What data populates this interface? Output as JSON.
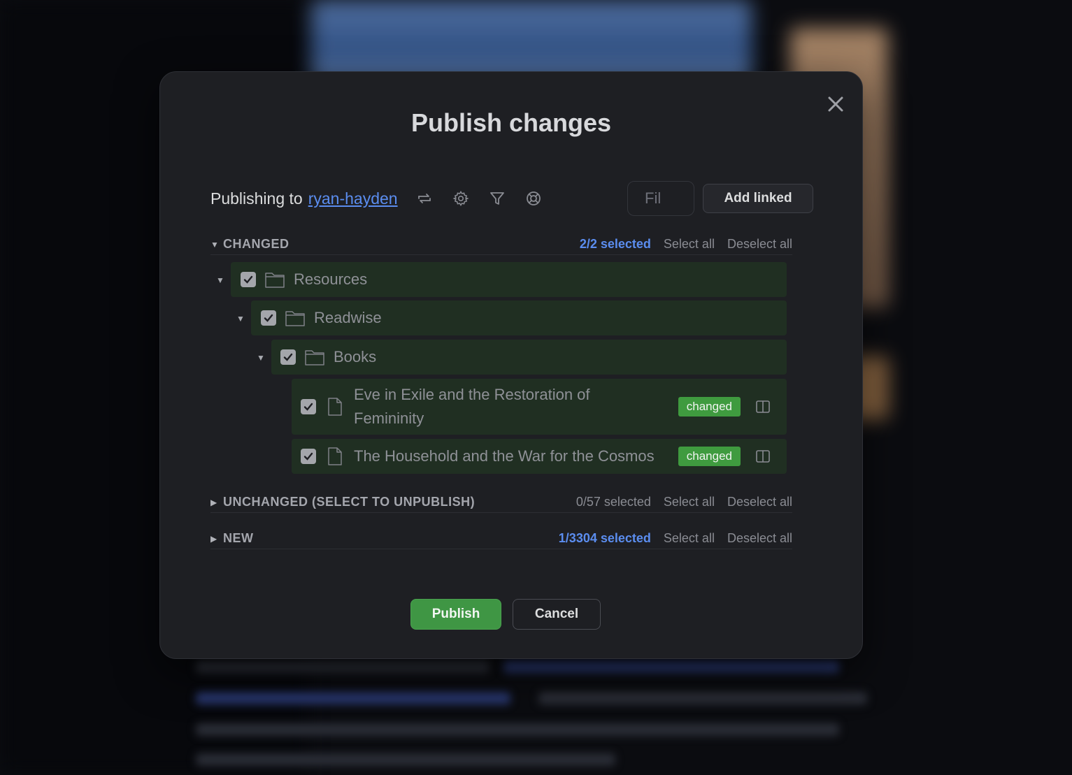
{
  "modal": {
    "title": "Publish changes",
    "publishing_to_label": "Publishing to",
    "target_name": "ryan-hayden",
    "filter_placeholder": "Fil",
    "add_linked_label": "Add linked"
  },
  "toolbar_icons": [
    "sync-icon",
    "gear-icon",
    "filter-icon",
    "help-lifebuoy-icon"
  ],
  "sections": {
    "changed": {
      "title": "CHANGED",
      "count": "2/2 selected",
      "select_all": "Select all",
      "deselect_all": "Deselect all",
      "expanded": true
    },
    "unchanged": {
      "title": "UNCHANGED (SELECT TO UNPUBLISH)",
      "count": "0/57 selected",
      "select_all": "Select all",
      "deselect_all": "Deselect all",
      "expanded": false
    },
    "new": {
      "title": "NEW",
      "count": "1/3304 selected",
      "select_all": "Select all",
      "deselect_all": "Deselect all",
      "expanded": false
    }
  },
  "tree": {
    "folders": [
      {
        "name": "Resources",
        "checked": true
      },
      {
        "name": "Readwise",
        "checked": true
      },
      {
        "name": "Books",
        "checked": true
      }
    ],
    "files": [
      {
        "name_line1": "Eve in Exile and the Restoration of",
        "name_line2": "Femininity",
        "badge": "changed",
        "checked": true
      },
      {
        "name_line1": "The Household and the War for the Cosmos",
        "badge": "changed",
        "checked": true
      }
    ]
  },
  "footer": {
    "publish_label": "Publish",
    "cancel_label": "Cancel"
  },
  "colors": {
    "accent_blue": "#5b8def",
    "badge_green": "#3f9b3f",
    "row_green": "#202f22",
    "modal_bg": "#1e1f23"
  }
}
